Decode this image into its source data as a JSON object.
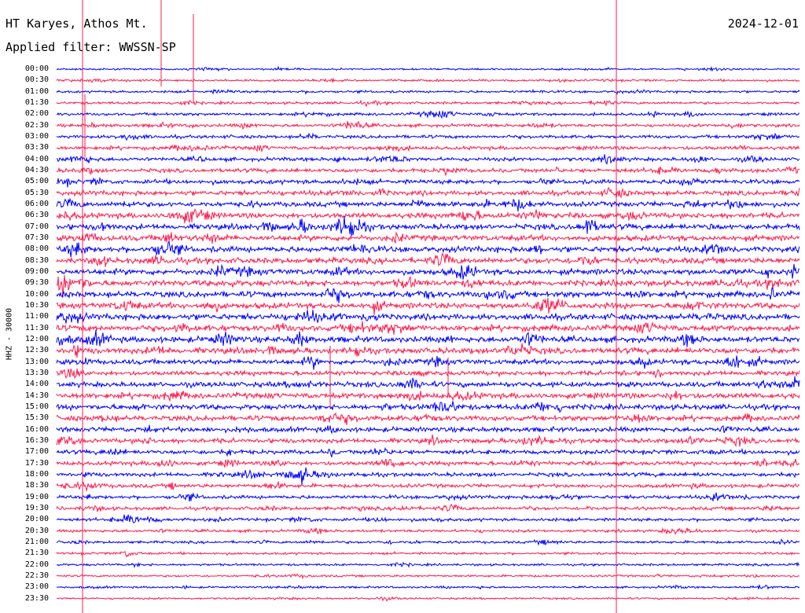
{
  "header": {
    "station": "HT Karyes, Athos Mt.",
    "filter": "Applied filter: WWSSN-SP",
    "date": "2024-12-01",
    "channel_label": "HHZ - 30000"
  },
  "colors": {
    "trace_a": "#0000ff",
    "trace_b": "#ff1a4d",
    "background": "#ffffff"
  },
  "chart_data": {
    "type": "line",
    "title": "HT Karyes, Athos Mt.",
    "ylabel": "HHZ - 30000",
    "grid": false,
    "row_labels": [
      "00:00",
      "00:30",
      "01:00",
      "01:30",
      "02:00",
      "02:30",
      "03:00",
      "03:30",
      "04:00",
      "04:30",
      "05:00",
      "05:30",
      "06:00",
      "06:30",
      "07:00",
      "07:30",
      "08:00",
      "08:30",
      "09:00",
      "09:30",
      "10:00",
      "10:30",
      "11:00",
      "11:30",
      "12:00",
      "12:30",
      "13:00",
      "13:30",
      "14:00",
      "14:30",
      "15:00",
      "15:30",
      "16:00",
      "16:30",
      "17:00",
      "17:30",
      "18:00",
      "18:30",
      "19:00",
      "19:30",
      "20:00",
      "20:30",
      "21:00",
      "21:30",
      "22:00",
      "22:30",
      "23:00",
      "23:30"
    ],
    "row_activity": [
      0.5,
      0.7,
      0.85,
      1.0,
      1.15,
      1.3,
      1.4,
      1.55,
      1.7,
      1.85,
      2.1,
      2.3,
      2.5,
      2.65,
      2.8,
      2.9,
      2.95,
      3.0,
      3.0,
      3.0,
      3.05,
      3.05,
      3.1,
      3.1,
      3.05,
      3.0,
      2.6,
      2.2,
      2.6,
      2.8,
      2.7,
      2.6,
      2.4,
      2.2,
      2.0,
      1.9,
      1.8,
      1.7,
      1.6,
      1.45,
      1.3,
      1.1,
      0.95,
      0.85,
      0.75,
      0.65,
      0.6,
      0.55
    ]
  }
}
